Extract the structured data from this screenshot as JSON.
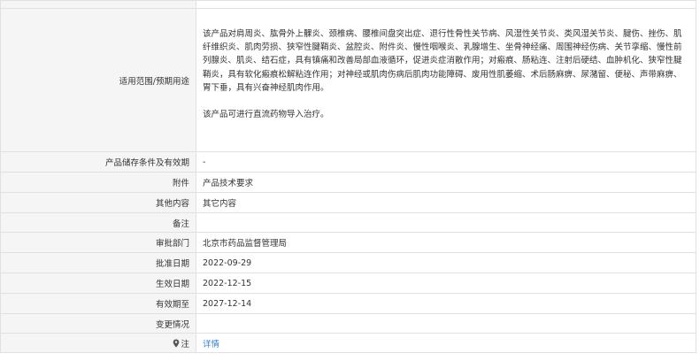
{
  "rows": {
    "scope": {
      "label": "适用范围/预期用途",
      "para1": "该产品对肩周炎、肱骨外上髁炎、颈椎病、腰椎间盘突出症、退行性骨性关节病、风湿性关节炎、类风湿关节炎、腱伤、挫伤、肌纤维织炎、肌肉劳损、狭窄性腱鞘炎、盆腔炎、附件炎、慢性咽喉炎、乳腺增生、坐骨神经痛、周围神经伤病、关节挛缩、慢性前列腺炎、肌炎、结石症，具有镇痛和改善局部血液循环，促进炎症消散作用；对瘢痕、肠粘连、注射后硬结、血肿机化、狭窄性腱鞘炎，具有软化瘢痕松解粘连作用；对神经或肌肉伤病后肌肉功能障碍、废用性肌萎缩、术后肠麻痹、尿潴留、便秘、声带麻痹、胃下垂，具有兴奋神经肌肉作用。",
      "para2": "该产品可进行直流药物导入治疗。"
    },
    "storage": {
      "label": "产品储存条件及有效期",
      "value": "-"
    },
    "attachment": {
      "label": "附件",
      "value": "产品技术要求"
    },
    "other": {
      "label": "其他内容",
      "value": "其它内容"
    },
    "remark": {
      "label": "备注",
      "value": ""
    },
    "authority": {
      "label": "审批部门",
      "value": "北京市药品监督管理局"
    },
    "approval_date": {
      "label": "批准日期",
      "value": "2022-09-29"
    },
    "effective_date": {
      "label": "生效日期",
      "value": "2022-12-15"
    },
    "valid_until": {
      "label": "有效期至",
      "value": "2027-12-14"
    },
    "change": {
      "label": "变更情况",
      "value": ""
    },
    "note": {
      "label": "注",
      "icon": "location-pin-icon",
      "link": "详情"
    }
  },
  "colors": {
    "label_bg": "#f5f5f5",
    "border": "#e1e1e1",
    "link": "#2f7fd6",
    "text": "#333333"
  }
}
